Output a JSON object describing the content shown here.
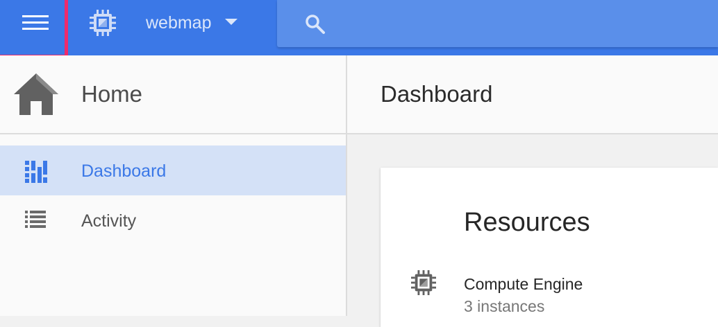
{
  "topbar": {
    "project_name": "webmap",
    "accent_color": "#3b78e7",
    "highlight_color": "#ee2a6c",
    "icons": [
      "menu-icon",
      "chip-icon",
      "caret-down-icon",
      "search-icon"
    ]
  },
  "sidebar": {
    "home_label": "Home",
    "items": [
      {
        "label": "Dashboard",
        "icon": "dashboard-icon",
        "active": true
      },
      {
        "label": "Activity",
        "icon": "list-icon",
        "active": false
      }
    ]
  },
  "main": {
    "title": "Dashboard",
    "card": {
      "title": "Resources",
      "resources": [
        {
          "name": "Compute Engine",
          "count": "3 instances",
          "icon": "chip-icon"
        }
      ]
    }
  }
}
